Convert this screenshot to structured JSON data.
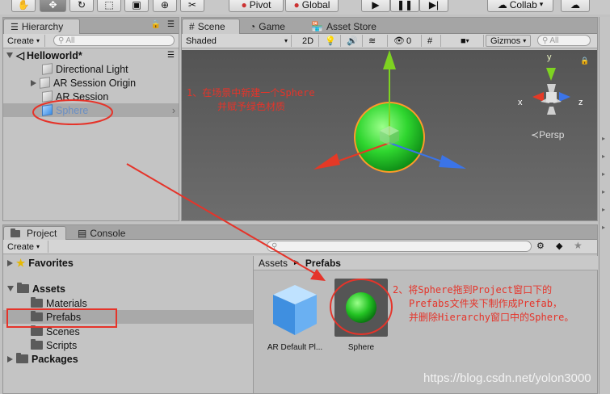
{
  "toolbar": {
    "pivot": "Pivot",
    "global": "Global",
    "collab": "Collab"
  },
  "hierarchy": {
    "tab": "Hierarchy",
    "create": "Create",
    "search_placeholder": "All",
    "scene_name": "Helloworld*",
    "items": [
      "Directional Light",
      "AR Session Origin",
      "AR Session",
      "Sphere"
    ]
  },
  "scene_view": {
    "tabs": [
      "Scene",
      "Game",
      "Asset Store"
    ],
    "shading": "Shaded",
    "mode_2d": "2D",
    "hidden_count": "0",
    "gizmos": "Gizmos",
    "search_placeholder": "All",
    "persp": "Persp",
    "axes": {
      "x": "x",
      "y": "y",
      "z": "z"
    }
  },
  "project": {
    "tabs": [
      "Project",
      "Console"
    ],
    "create": "Create",
    "favorites": "Favorites",
    "assets": "Assets",
    "folders": [
      "Materials",
      "Prefabs",
      "Scenes",
      "Scripts"
    ],
    "packages": "Packages",
    "breadcrumb": {
      "root": "Assets",
      "current": "Prefabs"
    },
    "grid_items": [
      "AR Default Pl...",
      "Sphere"
    ]
  },
  "annotations": {
    "step1_line1": "1、在场景中新建一个Sphere",
    "step1_line2": "并赋予绿色材质",
    "step2_line1": "2、将Sphere拖到Project窗口下的",
    "step2_line2": "Prefabs文件夹下制作成Prefab，",
    "step2_line3": "并删除Hierarchy窗口中的Sphere。"
  },
  "watermark": "https://blog.csdn.net/yolon3000",
  "colors": {
    "annotation": "#e5342a",
    "selection": "#a8a8a8",
    "sphere": "#2fd62f"
  }
}
